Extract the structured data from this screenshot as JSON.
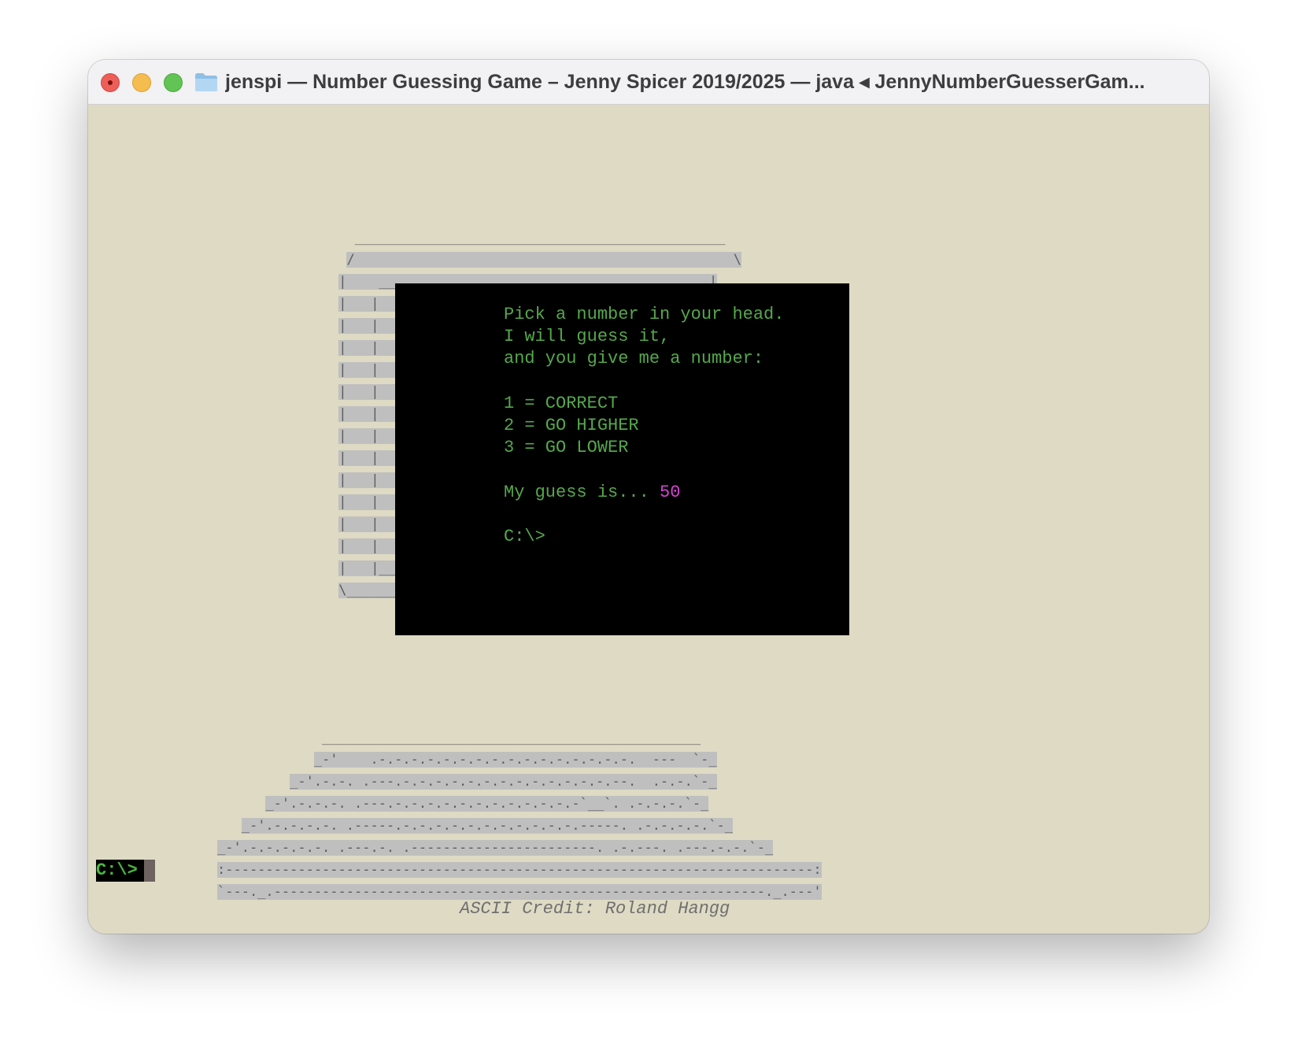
{
  "window": {
    "title": "jenspi — Number Guessing Game – Jenny Spicer 2019/2025 — java ◂ JennyNumberGuesserGam..."
  },
  "screen": {
    "lines": "Pick a number in your head.\nI will guess it,\nand you give me a number:\n\n1 = CORRECT\n2 = GO HIGHER\n3 = GO LOWER\n\n",
    "guess_prefix": "My guess is... ",
    "guess_value": "50",
    "screen_prompt": "\n\nC:\\>"
  },
  "credit": "ASCII Credit: Roland Hangg",
  "terminal": {
    "prompt": "C:\\>"
  },
  "colors": {
    "terminal_bg": "#dedac4",
    "crt_text": "#55a84b",
    "guess_highlight": "#d642d4",
    "ascii_fill": "#bfbfbf"
  }
}
